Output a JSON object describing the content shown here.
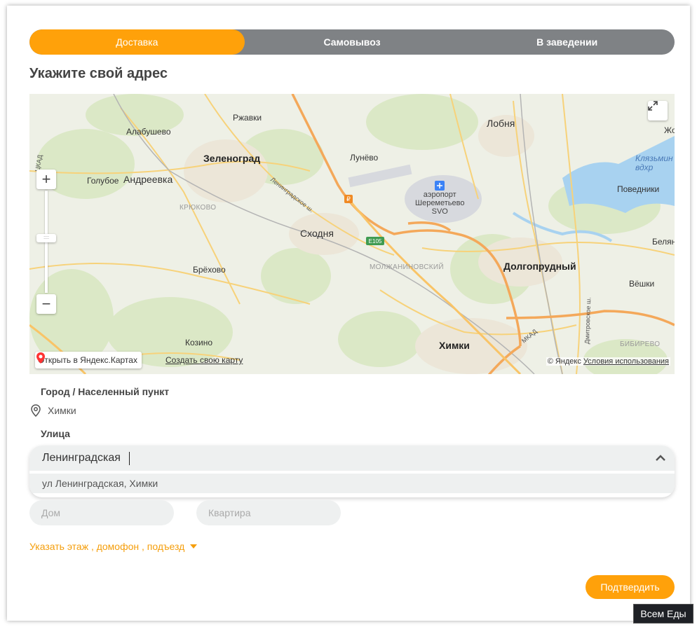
{
  "tabs": [
    {
      "label": "Доставка",
      "active": true
    },
    {
      "label": "Самовывоз",
      "active": false
    },
    {
      "label": "В заведении",
      "active": false
    }
  ],
  "page_title": "Укажите свой адрес",
  "map": {
    "labels": {
      "zelenograd": "Зеленоград",
      "andreevka": "Андреевка",
      "alabushevo": "Алабушево",
      "rzhavki": "Ржавки",
      "golubo": "Голубое",
      "kryukovo": "КРЮКОВО",
      "skhodnya": "Сходня",
      "lunevo": "Лунёво",
      "airport": "аэропорт\nШереметьево\nSVO",
      "lobnya": "Лобня",
      "dolgoprudny": "Долгопрудный",
      "khimki": "Химки",
      "molzhaninovsky": "МОЛЖАНИНОВСКИЙ",
      "brekhovo": "Брёхово",
      "kozino": "Козино",
      "povedniki": "Поведники",
      "vyoshki": "Вёшки",
      "bibirevo": "БИБИРЕВО",
      "klyazminskoe": "Клязьмин\nвдхр",
      "belyan": "Белян",
      "zh": "Жо",
      "leningradskoe": "Ленинградское ш.",
      "e105": "E105",
      "mkad": "МКАД",
      "dmitrovskoe": "Дмитровское ш.",
      "tsad": "ЦКАД"
    },
    "open_in_yandex": "Открыть в Яндекс.Картах",
    "create_map": "Создать свою карту",
    "copyright_prefix": "© Яндекс",
    "terms_link": "Условия использования"
  },
  "city": {
    "label": "Город / Населенный пункт",
    "value": "Химки"
  },
  "street": {
    "label": "Улица",
    "value": "Ленинградская",
    "suggestion": "ул Ленинградская, Химки"
  },
  "house": {
    "placeholder": "Дом"
  },
  "apartment": {
    "placeholder": "Квартира"
  },
  "extra_link": "Указать этаж , домофон , подъезд",
  "confirm_label": "Подтвердить",
  "badge": "Всем Еды",
  "colors": {
    "accent": "#ffa10a",
    "tab_bg": "#7f8285",
    "input_bg": "#eef0f0"
  }
}
